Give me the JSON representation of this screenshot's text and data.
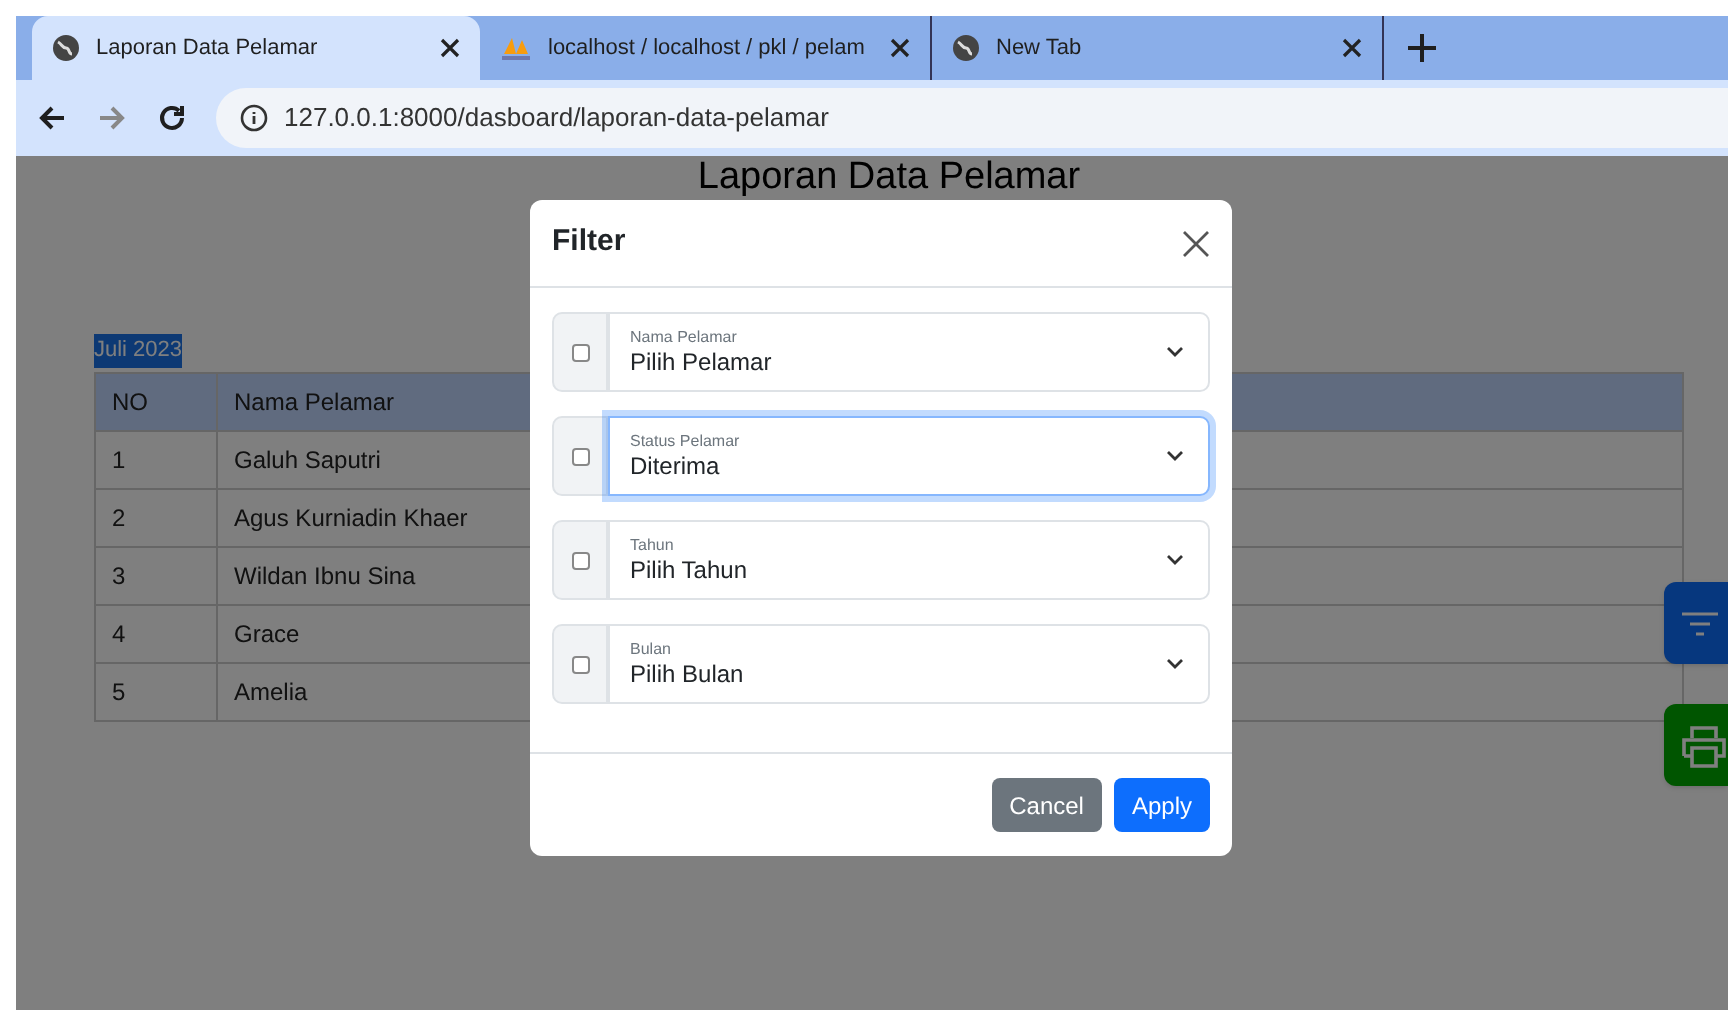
{
  "browser": {
    "tabs": [
      {
        "title": "Laporan Data Pelamar",
        "kind": "globe",
        "selected": true
      },
      {
        "title": "localhost / localhost / pkl / pelam",
        "kind": "sail",
        "selected": false
      },
      {
        "title": "New Tab",
        "kind": "globe",
        "selected": false
      }
    ],
    "url": "127.0.0.1:8000/dasboard/laporan-data-pelamar"
  },
  "page": {
    "title": "Laporan Data Pelamar",
    "period": "Juli 2023",
    "table": {
      "columns": [
        "NO",
        "Nama Pelamar"
      ],
      "rows": [
        [
          "1",
          "Galuh Saputri"
        ],
        [
          "2",
          "Agus Kurniadin Khaer"
        ],
        [
          "3",
          "Wildan Ibnu Sina"
        ],
        [
          "4",
          "Grace"
        ],
        [
          "5",
          "Amelia"
        ]
      ]
    }
  },
  "modal": {
    "title": "Filter",
    "fields": [
      {
        "label": "Nama Pelamar",
        "value": "Pilih Pelamar",
        "checked": false,
        "focused": false
      },
      {
        "label": "Status Pelamar",
        "value": "Diterima",
        "checked": false,
        "focused": true
      },
      {
        "label": "Tahun",
        "value": "Pilih Tahun",
        "checked": false,
        "focused": false
      },
      {
        "label": "Bulan",
        "value": "Pilih Bulan",
        "checked": false,
        "focused": false
      }
    ],
    "buttons": [
      {
        "label": "Cancel",
        "kind": "secondary"
      },
      {
        "label": "Apply",
        "kind": "primary"
      }
    ]
  }
}
